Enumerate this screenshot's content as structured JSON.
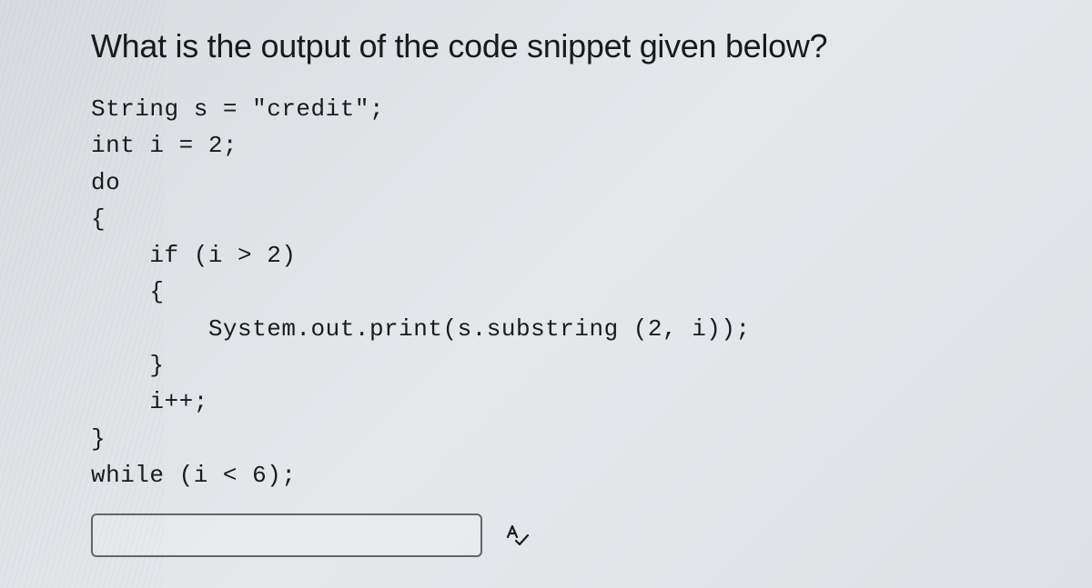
{
  "question": "What is the output of the code snippet given below?",
  "code": {
    "line1": "String s = \"credit\";",
    "line2": "int i = 2;",
    "line3": "do",
    "line4": "{",
    "line5": "    if (i > 2)",
    "line6": "    {",
    "line7": "        System.out.print(s.substring (2, i));",
    "line8": "    }",
    "line9": "    i++;",
    "line10": "}",
    "line11": "while (i < 6);"
  },
  "answer": {
    "value": "",
    "placeholder": ""
  }
}
